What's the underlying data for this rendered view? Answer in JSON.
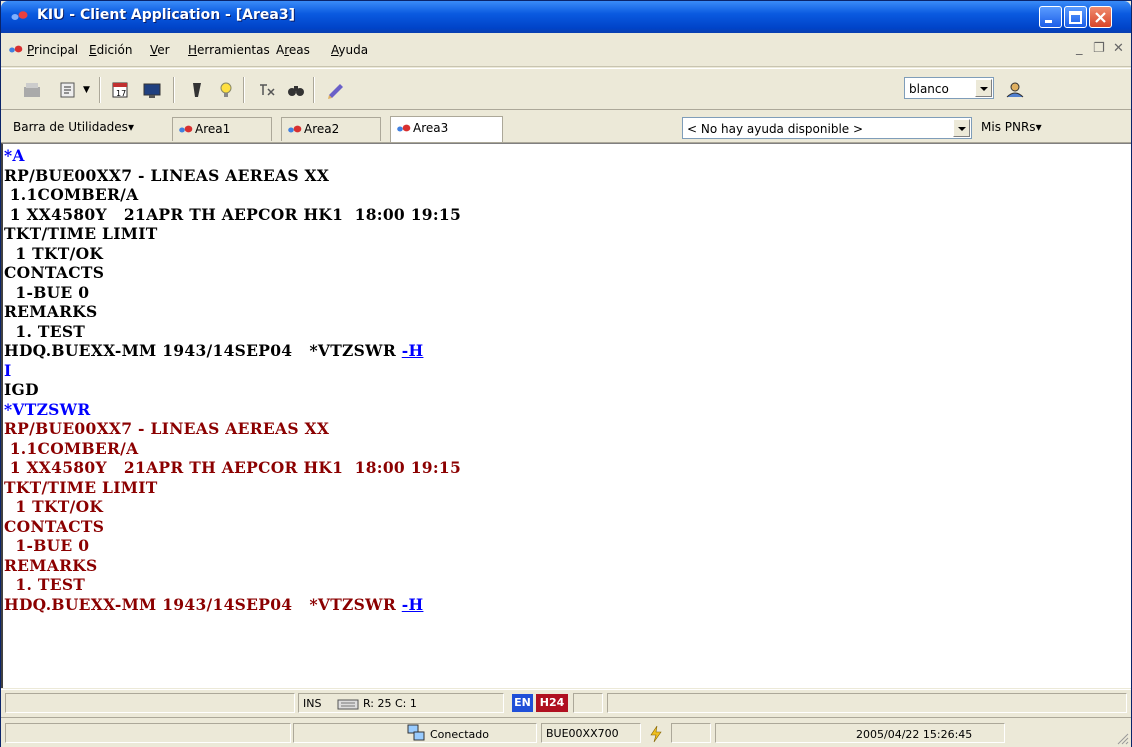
{
  "window": {
    "title": "KIU  -  Client Application - [Area3]"
  },
  "menubar": {
    "items": [
      "Principal",
      "Edición",
      "Ver",
      "Herramientas",
      "Areas",
      "Ayuda"
    ],
    "mnemonics": [
      "P",
      "E",
      "V",
      "H",
      "r",
      "A"
    ]
  },
  "toolbar": {
    "combo_value": "blanco",
    "icons": [
      "desk-icon",
      "stamp-icon",
      "calendar-icon",
      "monitor-icon",
      "cutter-icon",
      "lightbulb-icon",
      "translate-icon",
      "binoculars-icon",
      "pencil-icon",
      "user-icon"
    ]
  },
  "tabbar": {
    "utilities_label": "Barra de Utilidades",
    "tabs": [
      "Area1",
      "Area2",
      "Area3"
    ],
    "active_tab": "Area3",
    "help_value": "< No hay ayuda disponible >",
    "pnrs_label": "Mis PNRs"
  },
  "terminal": {
    "lines": [
      {
        "text": "*A",
        "color": "blue"
      },
      {
        "text": "RP/BUE00XX7 - LINEAS AEREAS XX",
        "color": "black"
      },
      {
        "text": " 1.1COMBER/A",
        "color": "black"
      },
      {
        "text": " 1 XX4580Y   21APR TH AEPCOR HK1  18:00 19:15",
        "color": "black"
      },
      {
        "text": "TKT/TIME LIMIT",
        "color": "black"
      },
      {
        "text": "  1 TKT/OK",
        "color": "black"
      },
      {
        "text": "CONTACTS",
        "color": "black"
      },
      {
        "text": "  1-BUE 0",
        "color": "black"
      },
      {
        "text": "REMARKS",
        "color": "black"
      },
      {
        "text": "  1. TEST",
        "color": "black"
      },
      {
        "text": "HDQ.BUEXX-MM 1943/14SEP04   *VTZSWR ",
        "color": "black",
        "link": "-H"
      },
      {
        "text": "I",
        "color": "blue"
      },
      {
        "text": "IGD",
        "color": "black"
      },
      {
        "text": "*VTZSWR",
        "color": "blue"
      },
      {
        "text": "RP/BUE00XX7 - LINEAS AEREAS XX",
        "color": "red"
      },
      {
        "text": " 1.1COMBER/A",
        "color": "red"
      },
      {
        "text": " 1 XX4580Y   21APR TH AEPCOR HK1  18:00 19:15",
        "color": "red"
      },
      {
        "text": "TKT/TIME LIMIT",
        "color": "red"
      },
      {
        "text": "  1 TKT/OK",
        "color": "red"
      },
      {
        "text": "CONTACTS",
        "color": "red"
      },
      {
        "text": "  1-BUE 0",
        "color": "red"
      },
      {
        "text": "REMARKS",
        "color": "red"
      },
      {
        "text": "  1. TEST",
        "color": "red"
      },
      {
        "text": "HDQ.BUEXX-MM 1943/14SEP04   *VTZSWR ",
        "color": "red",
        "link": "-H"
      }
    ]
  },
  "status1": {
    "ins": "INS",
    "cursor": "R: 25 C:  1",
    "lang": "EN",
    "h24": "H24"
  },
  "status2": {
    "connection": "Conectado",
    "station": "BUE00XX700",
    "datetime": "2005/04/22 15:26:45"
  },
  "colors": {
    "blue": "#0000ff",
    "red": "#8b0000",
    "black": "#000000",
    "badge_en": "#1f4fd8",
    "badge_h24": "#b01020"
  }
}
